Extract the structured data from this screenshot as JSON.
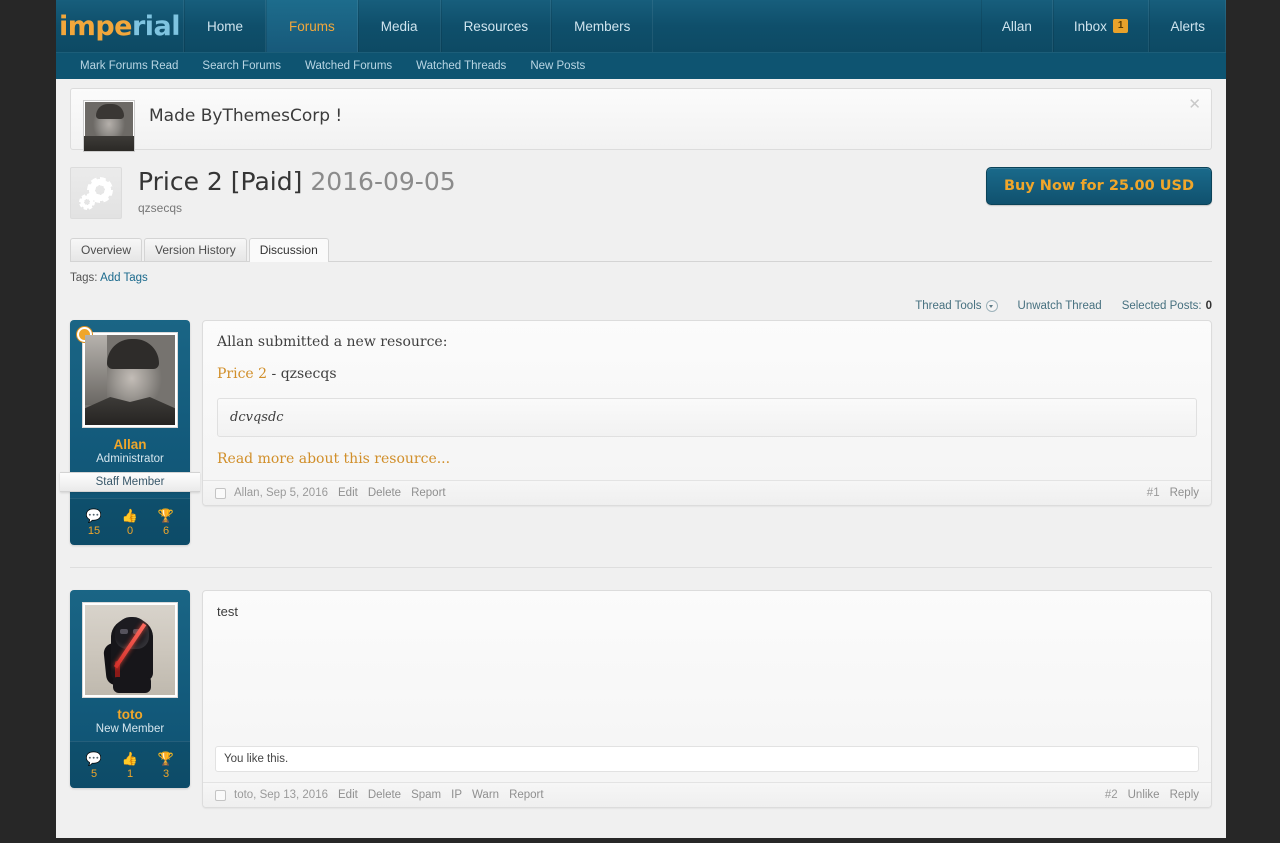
{
  "nav": {
    "logo": {
      "part1": "impe",
      "part2": "rial"
    },
    "items": [
      {
        "label": "Home",
        "active": false
      },
      {
        "label": "Forums",
        "active": true
      },
      {
        "label": "Media",
        "active": false
      },
      {
        "label": "Resources",
        "active": false
      },
      {
        "label": "Members",
        "active": false
      }
    ],
    "right": [
      {
        "label": "Allan",
        "badge": null
      },
      {
        "label": "Inbox",
        "badge": "1"
      },
      {
        "label": "Alerts",
        "badge": null
      }
    ],
    "subnav": [
      "Mark Forums Read",
      "Search Forums",
      "Watched Forums",
      "Watched Threads",
      "New Posts"
    ]
  },
  "notice": {
    "text": "Made ByThemesCorp !",
    "close_icon": "close-icon"
  },
  "resource": {
    "title": "Price 2 [Paid]",
    "date": "2016-09-05",
    "subtitle": "qzsecqs",
    "buy_button": "Buy Now for 25.00 USD",
    "icon": "gears-icon"
  },
  "tabs": [
    {
      "label": "Overview",
      "active": false
    },
    {
      "label": "Version History",
      "active": false
    },
    {
      "label": "Discussion",
      "active": true
    }
  ],
  "tags": {
    "label": "Tags:",
    "link": "Add Tags"
  },
  "thread_tools": {
    "tools_label": "Thread Tools",
    "unwatch_label": "Unwatch Thread",
    "selected_label": "Selected Posts:",
    "selected_count": "0"
  },
  "posts": [
    {
      "user": {
        "name": "Allan",
        "title": "Administrator",
        "banner": "Staff Member",
        "online": true,
        "avatar": "allan-photo",
        "stats": [
          {
            "icon": "messages-icon",
            "value": "15"
          },
          {
            "icon": "likes-icon",
            "value": "0"
          },
          {
            "icon": "trophy-icon",
            "value": "6"
          }
        ]
      },
      "body": {
        "intro": "Allan submitted a new resource:",
        "resource_link": "Price 2",
        "resource_dash": " - ",
        "resource_author": "qzsecqs",
        "quote": "dcvqsdc",
        "read_more": "Read more about this resource..."
      },
      "footer": {
        "meta": "Allan, Sep 5, 2016",
        "links": [
          "Edit",
          "Delete",
          "Report"
        ],
        "number": "#1",
        "right_links": [
          "Reply"
        ]
      }
    },
    {
      "user": {
        "name": "toto",
        "title": "New Member",
        "banner": null,
        "online": false,
        "avatar": "vader-art",
        "stats": [
          {
            "icon": "messages-icon",
            "value": "5"
          },
          {
            "icon": "likes-icon",
            "value": "1"
          },
          {
            "icon": "trophy-icon",
            "value": "3"
          }
        ]
      },
      "body": {
        "text": "test",
        "like_bar": "You like this."
      },
      "footer": {
        "meta": "toto, Sep 13, 2016",
        "links": [
          "Edit",
          "Delete",
          "Spam",
          "IP",
          "Warn",
          "Report"
        ],
        "number": "#2",
        "right_links": [
          "Unlike",
          "Reply"
        ]
      }
    }
  ],
  "colors": {
    "nav_blue": "#0f4f6b",
    "accent_orange": "#f0a62a",
    "page_bg": "#f0f0f0",
    "desktop_bg": "#272727",
    "link_blue": "#1b6a8d"
  }
}
